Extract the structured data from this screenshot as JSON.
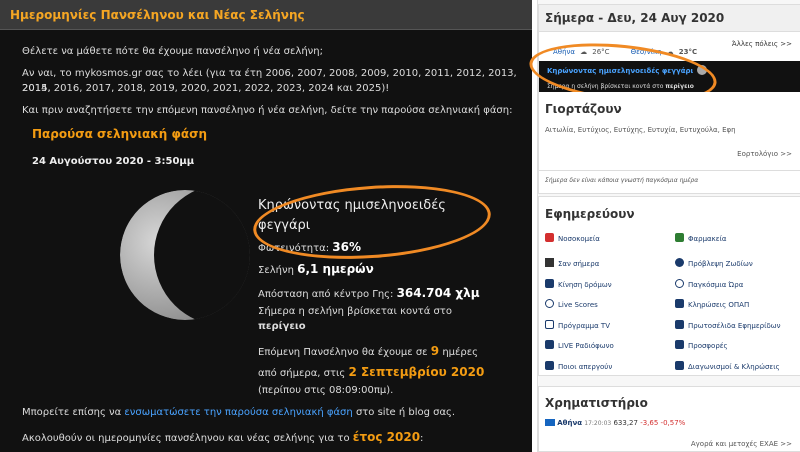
{
  "header": {
    "title": "Ημερομηνίες Πανσέληνου και Νέας Σελήνης"
  },
  "intro": {
    "line1": "Θέλετε να μάθετε πότε θα έχουμε πανσέληνο ή νέα σελήνη;",
    "line2": "Αν ναι, το mykosmos.gr σας το λέει (για τα έτη 2006, 2007, 2008, 2009, 2010, 2011, 2012, 2013, 2014,",
    "line3": "2015, 2016, 2017, 2018, 2019, 2020, 2021, 2022, 2023, 2024 και 2025)!",
    "line4": "Και πριν αναζητήσετε την επόμενη πανσέληνο ή νέα σελήνη, δείτε την παρούσα σεληνιακή φάση:"
  },
  "phase": {
    "heading": "Παρούσα σεληνιακή φάση",
    "datetime": "24 Αυγούστου 2020 - 3:50μμ",
    "name_line1": "Κηρώνοντας ημισεληνοειδές",
    "name_line2": "φεγγάρι",
    "brightness_label": "Φωτεινότητα:",
    "brightness_value": "36%",
    "age_label": "Σελήνη",
    "age_value": "6,1 ημερών",
    "distance_label": "Απόσταση από κέντρο Γης:",
    "distance_value": "364.704 χλμ",
    "position_line": "Σήμερα η σελήνη βρίσκεται κοντά στο",
    "position_value": "περίγειο",
    "next_prefix": "Επόμενη Πανσέληνο θα έχουμε σε",
    "next_days": "9",
    "next_suffix": "ημέρες",
    "next_from": "από σήμερα, στις",
    "next_date": "2 Σεπτεμβρίου 2020",
    "next_time": "(περίπου στις 08:09:00πμ)."
  },
  "embed": {
    "prefix": "Μπορείτε επίσης να",
    "link": "ενσωματώσετε την παρούσα σεληνιακή φάση",
    "suffix": "στο site ή blog σας."
  },
  "footer_line": {
    "prefix": "Ακολουθούν οι ημερομηνίες πανσέληνου και νέας σελήνης για το",
    "year": "έτος 2020",
    "suffix": ":"
  },
  "today": {
    "title": "Σήμερα - Δευ, 24 Αυγ 2020",
    "city1": "Αθήνα",
    "temp1": "26°C",
    "city2": "Θεσ/νίκη",
    "temp2": "23°C",
    "other": "Άλλες πόλεις >>",
    "moon_link": "Κηρώνοντας ημισεληνοειδές φεγγάρι",
    "moon_text": "Σήμερα η σελήνη βρίσκεται κοντά στο",
    "moon_bold": "περίγειο"
  },
  "names": {
    "title": "Γιορτάζουν",
    "list": "Αιτωλία, Ευτύχιος, Ευτύχης, Ευτυχία, Ευτυχούλα, Εφη",
    "more": "Εορτολόγιο >>",
    "note": "Σήμερα δεν είναι κάποια γνωστή παγκόσμια ημέρα"
  },
  "duty": {
    "title": "Εφημερεύουν",
    "items": [
      "Νοσοκομεία",
      "Φαρμακεία",
      "Σαν σήμερα",
      "Πρόβλεψη Ζωδίων",
      "Κίνηση δρόμων",
      "Παγκόσμια Ώρα",
      "Live Scores",
      "Κληρώσεις ΟΠΑΠ",
      "Πρόγραμμα TV",
      "Πρωτοσέλιδα Εφημερίδων",
      "LIVE Ραδιόφωνο",
      "Προσφορές",
      "Ποιοι απεργούν",
      "Διαγωνισμοί & Κληρώσεις"
    ]
  },
  "market": {
    "title": "Χρηματιστήριο",
    "city": "Αθήνα",
    "time": "17:20:03",
    "value": "633,27",
    "change": "-3,65",
    "pct": "-0,57%",
    "link": "Αγορά και μετοχές ΕΧΑΕ >>"
  },
  "colors": {
    "accent": "#f39c12",
    "annotation": "#f08a24",
    "link": "#1a5fb4"
  }
}
